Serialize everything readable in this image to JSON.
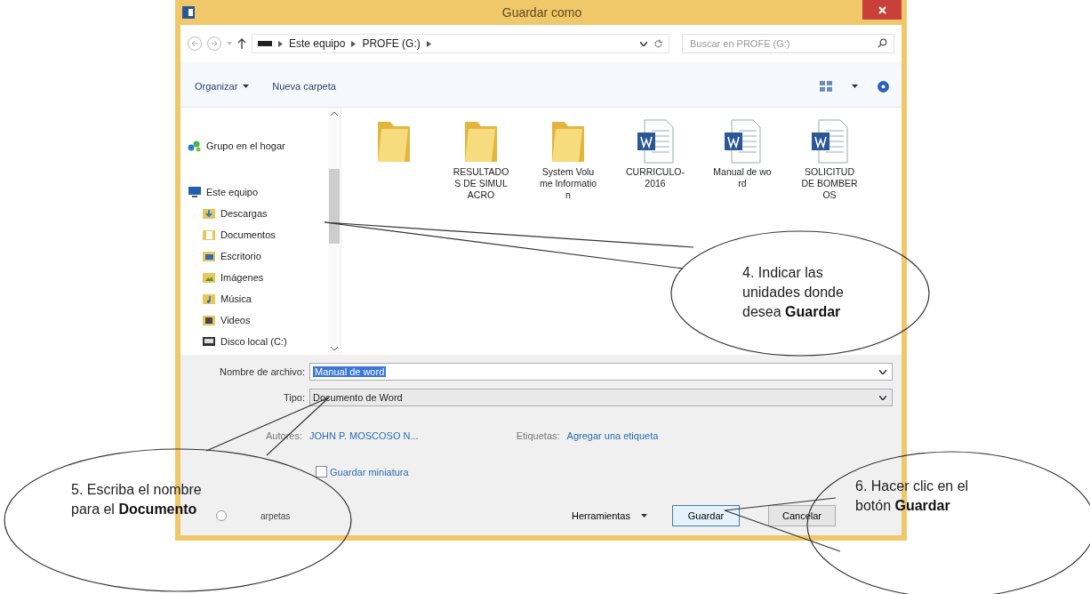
{
  "window": {
    "title": "Guardar como"
  },
  "address_bar": {
    "path": [
      "Este equipo",
      "PROFE (G:)"
    ]
  },
  "search": {
    "placeholder": "Buscar en PROFE (G:)"
  },
  "toolbar": [
    {
      "label": "Organizar",
      "kind": "menu"
    },
    {
      "label": "Nueva carpeta",
      "kind": "button"
    }
  ],
  "sidebar": {
    "items": [
      {
        "label": "Grupo en el hogar",
        "kind": "homegroup"
      },
      {
        "label": "Este equipo",
        "kind": "computer",
        "children": [
          {
            "label": "Descargas",
            "kind": "downloads"
          },
          {
            "label": "Documentos",
            "kind": "documents"
          },
          {
            "label": "Escritorio",
            "kind": "desktop"
          },
          {
            "label": "Imágenes",
            "kind": "pictures"
          },
          {
            "label": "Música",
            "kind": "music"
          },
          {
            "label": "Videos",
            "kind": "videos"
          },
          {
            "label": "Disco local (C:)",
            "kind": "drive"
          }
        ]
      }
    ]
  },
  "files": [
    {
      "kind": "folder"
    },
    {
      "name": "RESULTADOS DE SIMULACRO",
      "kind": "folder"
    },
    {
      "name": "System Volume Information",
      "kind": "folder"
    },
    {
      "name": "CURRICULO-2016",
      "kind": "word"
    },
    {
      "name": "Manual de word",
      "kind": "word"
    },
    {
      "name": "SOLICITUD DE BOMBEROS",
      "kind": "word"
    }
  ],
  "form": {
    "filename": {
      "label": "Nombre de archivo:",
      "value": "Manual de word",
      "text_selected": true
    },
    "type": {
      "label": "Tipo:",
      "value": "Documento de Word"
    },
    "authors": {
      "label": "Autores:",
      "value": "JOHN P. MOSCOSO N..."
    },
    "tags": {
      "label": "Etiquetas:",
      "value": "Agregar una etiqueta"
    },
    "thumbnail": {
      "label": "Guardar miniatura",
      "checked": false
    }
  },
  "footer": {
    "hide_folders": "arpetas",
    "tools": "Herramientas",
    "buttons": [
      {
        "label": "Guardar",
        "kind": "primary"
      },
      {
        "label": "Cancelar",
        "kind": "normal"
      }
    ]
  },
  "callouts": [
    {
      "lines": [
        "4.  Indicar las",
        "unidades donde",
        "desea **Guardar**"
      ]
    },
    {
      "lines": [
        "5.  Escriba el nombre",
        "para el **Documento**"
      ]
    },
    {
      "lines": [
        "6.  Hacer clic en el",
        "botón **Guardar**"
      ]
    }
  ]
}
